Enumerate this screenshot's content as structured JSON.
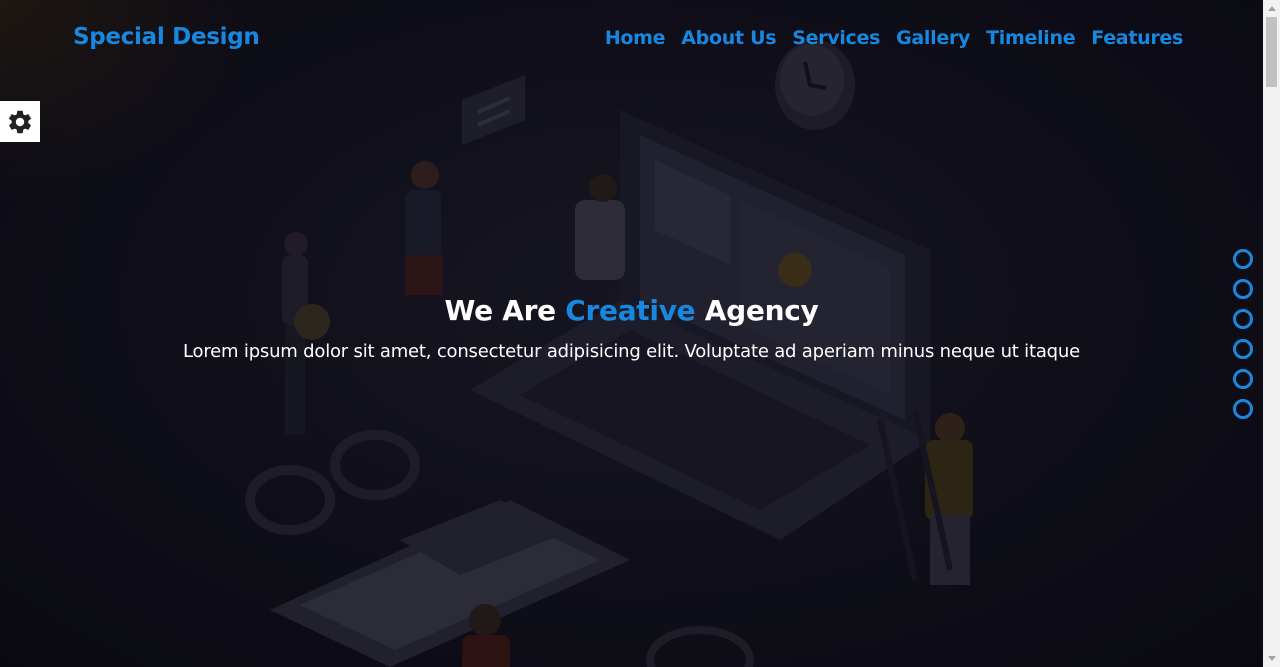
{
  "header": {
    "brand": "Special Design",
    "nav": [
      "Home",
      "About Us",
      "Services",
      "Gallery",
      "Timeline",
      "Features"
    ]
  },
  "settings": {
    "icon": "gear-icon"
  },
  "hero": {
    "title_before": "We Are",
    "title_accent": "Creative",
    "title_after": "Agency",
    "subtitle": "Lorem ipsum dolor sit amet, consectetur adipisicing elit. Voluptate ad aperiam minus neque ut itaque"
  },
  "bullets_count": 6,
  "colors": {
    "accent": "#1787e0",
    "text": "#ffffff",
    "background": "#12111c"
  }
}
